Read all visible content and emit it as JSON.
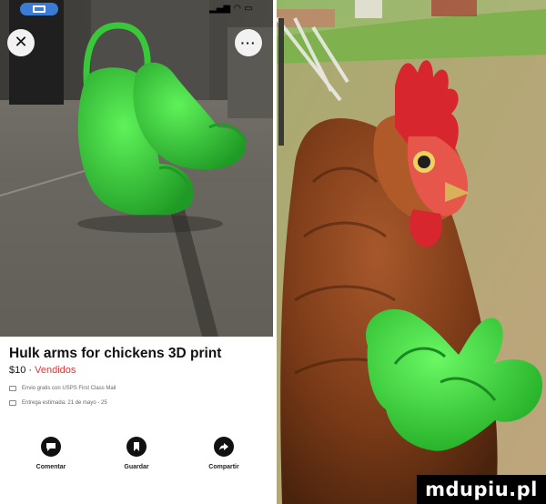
{
  "listing": {
    "title": "Hulk arms for chickens 3D print",
    "price": "$10",
    "separator": " · ",
    "status": "Vendidos",
    "shipping": "Envio gratis con USPS First Class Mail",
    "estimated": "Entrega estimada: 21 de mayo - 25"
  },
  "actions": [
    {
      "label": "Comentar",
      "icon": "comment-icon"
    },
    {
      "label": "Guardar",
      "icon": "bookmark-icon"
    },
    {
      "label": "Compartir",
      "icon": "share-icon"
    }
  ],
  "watermark": "mdupiu.pl",
  "colors": {
    "hulk_green": "#3bd23c",
    "sold_red": "#d33c3c",
    "status_pill": "#3a7bd5"
  }
}
